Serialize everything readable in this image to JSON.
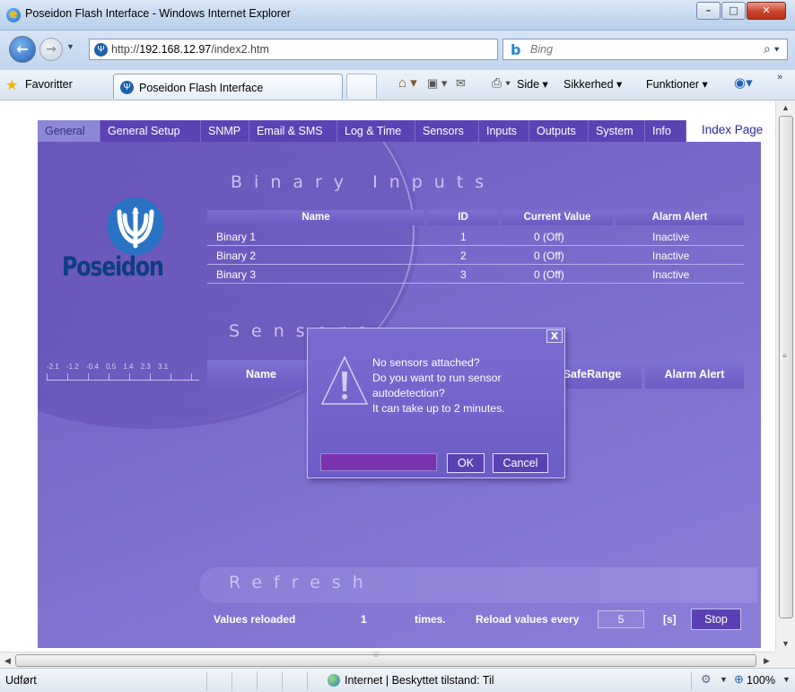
{
  "window": {
    "title": "Poseidon Flash Interface - Windows Internet Explorer",
    "minimize": "–",
    "maximize": "□",
    "close": "✕"
  },
  "address": {
    "url_prefix": "http://",
    "url_host": "192.168.12.97",
    "url_path": "/index2.htm",
    "search_placeholder": "Bing"
  },
  "command_bar": {
    "favorites": "Favoritter",
    "tab_title": "Poseidon Flash Interface",
    "menus": [
      "Side ▾",
      "Sikkerhed ▾",
      "Funktioner ▾"
    ]
  },
  "nav": {
    "tabs": [
      "General",
      "General Setup",
      "SNMP",
      "Email & SMS",
      "Log & Time",
      "Sensors",
      "Inputs",
      "Outputs",
      "System",
      "Info"
    ],
    "active_tab": "General",
    "index_link": "Index Page"
  },
  "brand": {
    "logo_text": "Poseidon"
  },
  "binary_inputs": {
    "title": "Binary Inputs",
    "columns": [
      "Name",
      "ID",
      "Current Value",
      "Alarm Alert"
    ],
    "rows": [
      [
        "Binary 1",
        "1",
        "0 (Off)",
        "Inactive"
      ],
      [
        "Binary 2",
        "2",
        "0 (Off)",
        "Inactive"
      ],
      [
        "Binary 3",
        "3",
        "0 (Off)",
        "Inactive"
      ]
    ]
  },
  "sensors": {
    "title": "Sensors",
    "scale_labels": "-2.1 -1.2 -0.4 0.5 1.4 2.3 3.1",
    "columns": [
      "Name",
      "SafeRange",
      "Alarm Alert"
    ]
  },
  "refresh": {
    "title": "Refresh",
    "values_reloaded_label": "Values reloaded",
    "reload_count": "1",
    "times_label": "times.",
    "reload_every_label": "Reload values every",
    "interval_value": "5",
    "unit_label": "[s]",
    "stop_button": "Stop"
  },
  "dialog": {
    "close_label": "X",
    "lines": [
      "No sensors attached?",
      "Do you want to run sensor",
      "autodetection?",
      "It can take up to 2 minutes."
    ],
    "ok_label": "OK",
    "cancel_label": "Cancel"
  },
  "status": {
    "text": "Udført",
    "zone": "Internet | Beskyttet tilstand: Til",
    "zoom": "100%"
  },
  "colors": {
    "panel": "#7b6ccc",
    "nav_tab": "#5b43b5",
    "logo_blue": "#2a73c4",
    "logo_text": "#0d3e7f"
  }
}
